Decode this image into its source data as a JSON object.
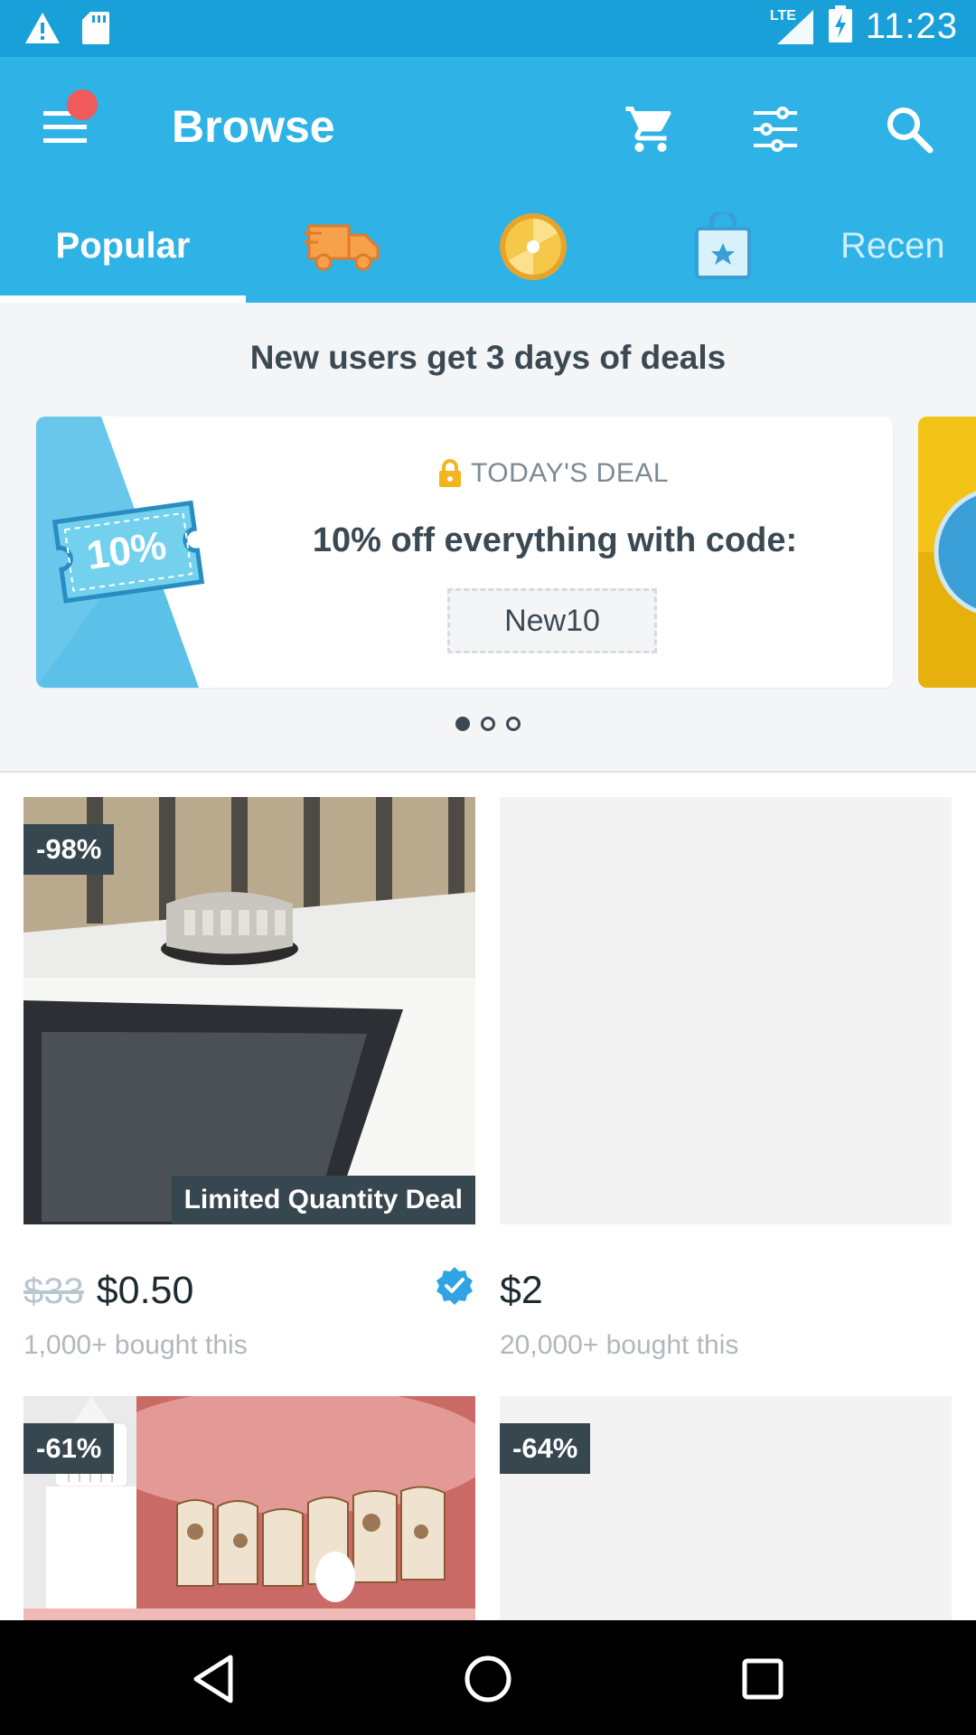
{
  "status_bar": {
    "time": "11:23",
    "network": "LTE",
    "icons": [
      "warning-icon",
      "sd-card-icon",
      "signal-icon",
      "battery-charging-icon"
    ]
  },
  "app_bar": {
    "title": "Browse",
    "menu_has_notification": true,
    "actions": [
      "cart-icon",
      "filter-icon",
      "search-icon"
    ]
  },
  "tabs": [
    {
      "label": "Popular",
      "active": true
    },
    {
      "icon": "delivery-truck-icon"
    },
    {
      "icon": "wheel-badge-icon"
    },
    {
      "icon": "shopping-bag-icon"
    },
    {
      "label": "Recen"
    }
  ],
  "promo": {
    "headline": "New users get 3 days of deals",
    "card": {
      "coupon_text": "10%",
      "kicker": "TODAY'S DEAL",
      "text": "10% off everything with code:",
      "code": "New10"
    },
    "pagination": {
      "count": 3,
      "active_index": 0
    }
  },
  "products": [
    {
      "discount": "-98%",
      "ribbon": "Limited Quantity Deal",
      "old_price": "$33",
      "price": "$0.50",
      "bought": "1,000+ bought this",
      "verified": true
    },
    {
      "price": "$2",
      "bought": "20,000+ bought this"
    },
    {
      "discount": "-61%"
    },
    {
      "discount": "-64%"
    }
  ],
  "colors": {
    "primary": "#2fb3e6",
    "status_bar": "#1aa0d8",
    "badge": "#37474f",
    "deal_yellow": "#f2c418"
  },
  "nav_bar": {
    "buttons": [
      "back-icon",
      "home-icon",
      "recents-icon"
    ]
  }
}
